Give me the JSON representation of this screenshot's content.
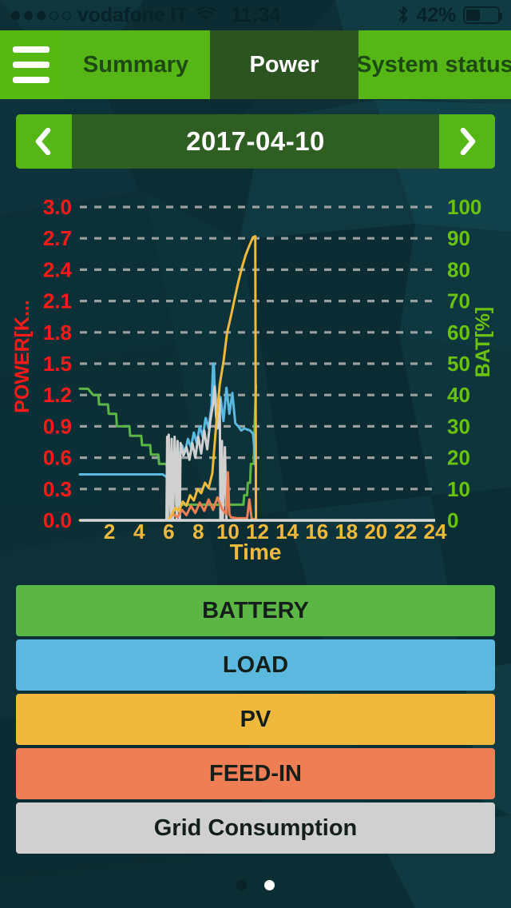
{
  "status_bar": {
    "signal_dots_filled": 3,
    "signal_dots_total": 5,
    "carrier": "vodafone IT",
    "wifi_icon": "wifi-icon",
    "time": "11:34",
    "bluetooth_icon": "bluetooth-icon",
    "battery_percent": "42%",
    "battery_level": 42
  },
  "nav": {
    "menu_icon": "hamburger-menu-icon",
    "tabs": [
      {
        "label": "Summary",
        "active": false
      },
      {
        "label": "Power",
        "active": true
      },
      {
        "label": "System status",
        "active": false
      }
    ]
  },
  "date_nav": {
    "prev_icon": "chevron-left-icon",
    "date": "2017-04-10",
    "next_icon": "chevron-right-icon"
  },
  "legend": [
    {
      "label": "BATTERY",
      "color": "#5cb646"
    },
    {
      "label": "LOAD",
      "color": "#5bb8df"
    },
    {
      "label": "PV",
      "color": "#eeb93c"
    },
    {
      "label": "FEED-IN",
      "color": "#ef7e54"
    },
    {
      "label": "Grid Consumption",
      "color": "#d0d0d0"
    }
  ],
  "pagination": {
    "total": 2,
    "active_index": 1
  },
  "colors": {
    "accent_green": "#56b615",
    "accent_green_bright": "#56b910",
    "tab_active_bg": "#2c5420",
    "date_bg": "#2e5e22",
    "page_bg": "#0d2f35",
    "left_axis": "#ff1a1a",
    "right_axis": "#69c20f",
    "x_axis": "#eeb93c",
    "gridline": "#9aa0a0"
  },
  "chart_data": {
    "type": "line",
    "title": "",
    "xlabel": "Time",
    "ylabel_left": "POWER[K...",
    "ylabel_right": "BAT[%]",
    "xlim": [
      0,
      24
    ],
    "xticks": [
      2,
      4,
      6,
      8,
      10,
      12,
      14,
      16,
      18,
      20,
      22,
      24
    ],
    "ylim_left": [
      0.0,
      3.0
    ],
    "yticks_left": [
      0.0,
      0.3,
      0.6,
      0.9,
      1.2,
      1.5,
      1.8,
      2.1,
      2.4,
      2.7,
      3.0
    ],
    "ylim_right": [
      0,
      100
    ],
    "yticks_right": [
      0,
      10,
      20,
      30,
      40,
      50,
      60,
      70,
      80,
      90,
      100
    ],
    "grid": true,
    "legend_position": "below-as-buttons",
    "note": "Data recorded only up to about 11.9 h; all series stop there.",
    "series": [
      {
        "name": "BATTERY",
        "color": "#5cb646",
        "axis": "right",
        "unit": "%",
        "x": [
          0.0,
          0.55,
          0.9,
          1.25,
          1.3,
          1.9,
          1.95,
          2.45,
          2.5,
          3.35,
          3.4,
          4.15,
          4.2,
          4.75,
          4.8,
          5.3,
          5.35,
          5.85,
          5.9,
          6.1,
          6.15,
          6.45,
          6.5,
          11.05,
          11.1,
          11.3,
          11.35,
          11.5,
          11.55,
          11.75,
          11.8,
          11.9
        ],
        "y": [
          42,
          42,
          40,
          40,
          37,
          37,
          34,
          34,
          30,
          30,
          27,
          27,
          24,
          24,
          21,
          21,
          18,
          18,
          16,
          16,
          15,
          15,
          5,
          5,
          8,
          8,
          12,
          12,
          18,
          18,
          30,
          43
        ]
      },
      {
        "name": "LOAD",
        "color": "#5bb8df",
        "axis": "left",
        "unit": "kW",
        "x": [
          0.0,
          5.6,
          5.9,
          6.1,
          6.3,
          6.5,
          6.7,
          6.9,
          7.1,
          7.3,
          7.5,
          7.7,
          7.9,
          8.1,
          8.3,
          8.5,
          8.7,
          8.9,
          9.0,
          9.05,
          9.1,
          9.3,
          9.5,
          9.7,
          9.9,
          10.1,
          10.3,
          10.5,
          10.7,
          10.9,
          11.1,
          11.3,
          11.5,
          11.7,
          11.9
        ],
        "y": [
          0.44,
          0.44,
          0.41,
          0.62,
          0.57,
          0.68,
          0.6,
          0.72,
          0.65,
          0.78,
          0.7,
          0.84,
          0.74,
          0.9,
          0.8,
          0.98,
          0.88,
          1.1,
          1.5,
          1.5,
          1.3,
          1.05,
          1.18,
          0.95,
          1.27,
          1.02,
          1.22,
          0.93,
          0.9,
          0.86,
          0.88,
          0.87,
          0.86,
          0.83,
          0.5
        ]
      },
      {
        "name": "PV",
        "color": "#eeb93c",
        "axis": "left",
        "unit": "kW",
        "x": [
          0.0,
          5.95,
          6.2,
          6.45,
          6.7,
          6.95,
          7.2,
          7.45,
          7.7,
          7.95,
          8.2,
          8.45,
          8.7,
          8.95,
          9.2,
          9.45,
          9.7,
          9.95,
          10.2,
          10.45,
          10.7,
          10.95,
          11.2,
          11.45,
          11.7,
          11.85,
          11.9
        ],
        "y": [
          0.0,
          0.0,
          0.05,
          0.12,
          0.09,
          0.18,
          0.14,
          0.24,
          0.19,
          0.3,
          0.26,
          0.36,
          0.31,
          0.45,
          0.9,
          1.3,
          1.52,
          1.8,
          1.95,
          2.12,
          2.28,
          2.42,
          2.54,
          2.63,
          2.71,
          2.72,
          0.0
        ]
      },
      {
        "name": "FEED-IN",
        "color": "#ef7e54",
        "axis": "left",
        "unit": "kW",
        "x": [
          0.0,
          5.95,
          6.3,
          6.6,
          6.9,
          7.2,
          7.5,
          7.8,
          8.1,
          8.4,
          8.7,
          9.0,
          9.3,
          9.6,
          9.9,
          10.0,
          10.1,
          10.2,
          10.6,
          11.0,
          11.3,
          11.45,
          11.6,
          11.9
        ],
        "y": [
          0.0,
          0.0,
          0.06,
          0.03,
          0.1,
          0.05,
          0.14,
          0.07,
          0.17,
          0.09,
          0.2,
          0.1,
          0.22,
          0.11,
          0.06,
          0.46,
          0.06,
          0.03,
          0.02,
          0.02,
          0.02,
          0.2,
          0.02,
          0.0
        ]
      },
      {
        "name": "Grid Consumption",
        "color": "#d0d0d0",
        "axis": "left",
        "unit": "kW",
        "x": [
          0.0,
          5.85,
          5.9,
          5.95,
          6.0,
          6.15,
          6.2,
          6.3,
          6.4,
          6.55,
          6.6,
          6.75,
          6.8,
          7.0,
          7.2,
          7.4,
          7.6,
          7.8,
          8.0,
          8.2,
          8.4,
          8.6,
          8.8,
          9.0,
          9.1,
          9.2,
          9.3,
          9.45,
          9.5,
          9.6,
          9.65,
          9.8,
          9.9,
          11.9
        ],
        "y": [
          0.0,
          0.0,
          0.8,
          0.0,
          0.82,
          0.0,
          0.78,
          0.0,
          0.8,
          0.0,
          0.76,
          0.0,
          0.74,
          0.62,
          0.7,
          0.58,
          0.74,
          0.6,
          0.8,
          0.64,
          0.86,
          0.68,
          0.94,
          1.12,
          1.28,
          1.0,
          0.88,
          1.16,
          0.0,
          0.76,
          0.0,
          0.7,
          0.0,
          0.0
        ]
      }
    ]
  }
}
